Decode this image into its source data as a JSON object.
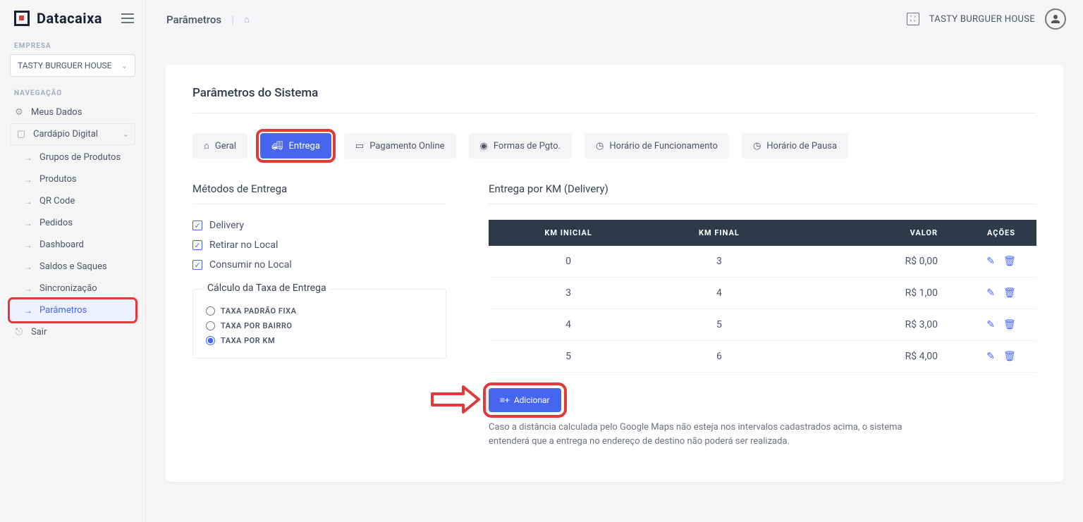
{
  "brand": {
    "name": "Datacaixa"
  },
  "header": {
    "company": "TASTY BURGUER HOUSE"
  },
  "sidebar": {
    "empresaLabel": "EMPRESA",
    "company": "TASTY BURGUER HOUSE",
    "navLabel": "NAVEGAÇÃO",
    "meusDados": "Meus Dados",
    "cardapio": "Cardápio Digital",
    "items": [
      "Grupos de Produtos",
      "Produtos",
      "QR Code",
      "Pedidos",
      "Dashboard",
      "Saldos e Saques",
      "Sincronização",
      "Parâmetros"
    ],
    "sair": "Sair"
  },
  "breadcrumb": {
    "title": "Parâmetros"
  },
  "card": {
    "title": "Parâmetros do Sistema",
    "tabs": {
      "geral": "Geral",
      "entrega": "Entrega",
      "pagamento": "Pagamento Online",
      "formas": "Formas de Pgto.",
      "horarioFunc": "Horário de Funcionamento",
      "horarioPausa": "Horário de Pausa"
    },
    "left": {
      "title": "Métodos de Entrega",
      "checks": {
        "delivery": "Delivery",
        "retirar": "Retirar no Local",
        "consumir": "Consumir no Local"
      },
      "calcTitle": "Cálculo da Taxa de Entrega",
      "radios": {
        "fixa": "TAXA PADRÃO FIXA",
        "bairro": "TAXA POR BAIRRO",
        "km": "TAXA POR KM"
      }
    },
    "right": {
      "title": "Entrega por KM (Delivery)",
      "headers": {
        "kmInicial": "KM INICIAL",
        "kmFinal": "KM FINAL",
        "valor": "VALOR",
        "acoes": "AÇÕES"
      },
      "rows": [
        {
          "ini": "0",
          "fin": "3",
          "val": "R$ 0,00"
        },
        {
          "ini": "3",
          "fin": "4",
          "val": "R$ 1,00"
        },
        {
          "ini": "4",
          "fin": "5",
          "val": "R$ 3,00"
        },
        {
          "ini": "5",
          "fin": "6",
          "val": "R$ 4,00"
        }
      ],
      "addLabel": "Adicionar",
      "note": "Caso a distância calculada pelo Google Maps não esteja nos intervalos cadastrados acima, o sistema entenderá que a entrega no endereço de destino não poderá ser realizada."
    }
  }
}
